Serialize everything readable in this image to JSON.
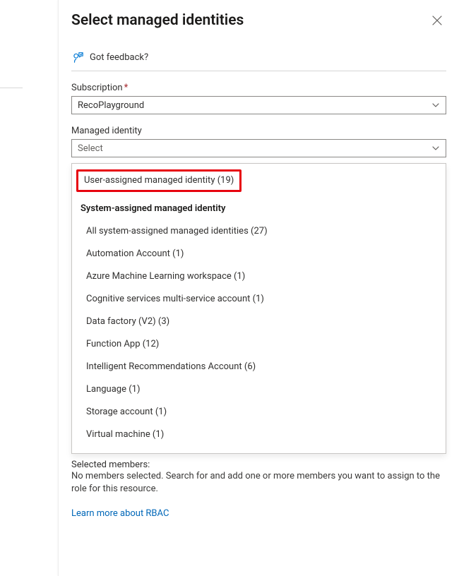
{
  "title": "Select managed identities",
  "feedback_label": "Got feedback?",
  "subscription": {
    "label": "Subscription",
    "required_mark": "*",
    "value": "RecoPlayground"
  },
  "managed_identity": {
    "label": "Managed identity",
    "placeholder": "Select"
  },
  "dropdown": {
    "user_assigned_label": "User-assigned managed identity (19)",
    "system_assigned_header": "System-assigned managed identity",
    "sub_options": [
      "All system-assigned managed identities (27)",
      "Automation Account (1)",
      "Azure Machine Learning workspace (1)",
      "Cognitive services multi-service account (1)",
      "Data factory (V2) (3)",
      "Function App (12)",
      "Intelligent Recommendations Account (6)",
      "Language (1)",
      "Storage account (1)",
      "Virtual machine (1)"
    ]
  },
  "selected": {
    "title": "Selected members:",
    "message": "No members selected. Search for and add one or more members you want to assign to the role for this resource."
  },
  "learn_more": "Learn more about RBAC"
}
